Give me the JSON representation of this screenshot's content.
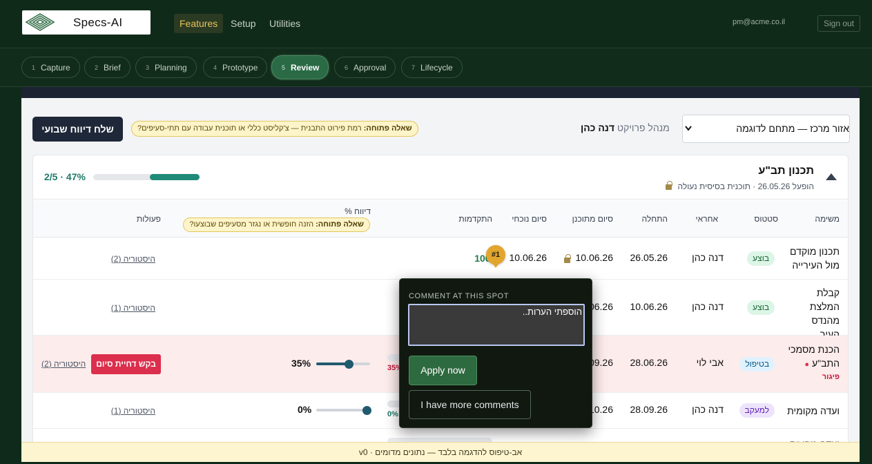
{
  "header": {
    "logo_text": "Specs-AI",
    "nav": [
      "Features",
      "Setup",
      "Utilities"
    ],
    "active_nav": "Features",
    "user_email": "pm@acme.co.il",
    "signout_label": "Sign out"
  },
  "steps": [
    {
      "num": "1",
      "label": "Capture"
    },
    {
      "num": "2",
      "label": "Brief"
    },
    {
      "num": "3",
      "label": "Planning"
    },
    {
      "num": "4",
      "label": "Prototype"
    },
    {
      "num": "5",
      "label": "Review",
      "active": true
    },
    {
      "num": "6",
      "label": "Approval"
    },
    {
      "num": "7",
      "label": "Lifecycle"
    }
  ],
  "toolbar": {
    "area_select": "אזור מרכז — מתחם לדוגמה",
    "pm_label": "מנהל פרויקט",
    "pm_name": "דנה כהן",
    "open_q_label": "שאלה פתוחה:",
    "open_q_text": "רמת פירוט התבנית — צ'קליסט כללי או תוכנית עבודה עם תתי-סעיפים?",
    "weekly_btn": "שלח דיווח שבועי"
  },
  "section": {
    "title": "תכנון תב\"ע",
    "subtitle": "הופעל 26.05.26 · תוכנית בסיסית נעולה",
    "progress_text": "2/5 · 47%",
    "progress_fraction": 0.47
  },
  "columns": {
    "task": "משימה",
    "status": "סטטוס",
    "owner": "אחראי",
    "start": "התחלה",
    "planned_end": "סיום מתוכנן",
    "current_end": "סיום נוכחי",
    "progress": "התקדמות",
    "report_pct": "דיווח %",
    "report_q_label": "שאלה פתוחה:",
    "report_q_text": "הזנה חופשית או נגזר מסעיפים שבוצעו?",
    "actions": "פעולות"
  },
  "rows": [
    {
      "task": "תכנון מוקדם מול העירייה",
      "status": "בוצע",
      "owner": "דנה כהן",
      "start": "26.05.26",
      "planned_end": "10.06.26",
      "current_end": "10.06.26",
      "progress_text": "100%",
      "history": "היסטוריה (2)"
    },
    {
      "task": "קבלת המלצת מהנדס העיר",
      "status": "בוצע",
      "owner": "דנה כהן",
      "start": "10.06.26",
      "planned_end": "10.06.26",
      "history": "היסטוריה (1)"
    },
    {
      "task": "הכנת מסמכי התב\"ע",
      "delay_tag": "פיגור",
      "status": "בטיפול",
      "owner": "אבי לוי",
      "start": "28.06.26",
      "planned_end": "28.09.26",
      "progress_text": "35%",
      "report_pct": "35%",
      "report_value": 35,
      "delay_btn": "בקש דחיית סיום",
      "history": "היסטוריה (2)"
    },
    {
      "task": "ועדה מקומית",
      "status": "למעקב",
      "owner": "דנה כהן",
      "start": "28.09.26",
      "planned_end": "28.10.26",
      "progress_text": "0%",
      "report_pct": "0%",
      "report_value": 0,
      "history": "היסטוריה (1)"
    },
    {
      "task": "ועדה מחוזית"
    }
  ],
  "comment": {
    "marker": "#1",
    "title": "COMMENT AT THIS SPOT",
    "input_value": "הוספתי הערות..",
    "apply_label": "Apply now",
    "more_label": "I have more comments"
  },
  "footer": {
    "text": "אב-טיפוס להדגמה בלבד — נתונים מדומים · v0"
  },
  "colors": {
    "brand_dark": "#102a19",
    "accent_gold": "#e7c35a",
    "active_step": "#2a6a45",
    "progress_teal": "#1f8a78",
    "danger": "#dc2f4d"
  }
}
